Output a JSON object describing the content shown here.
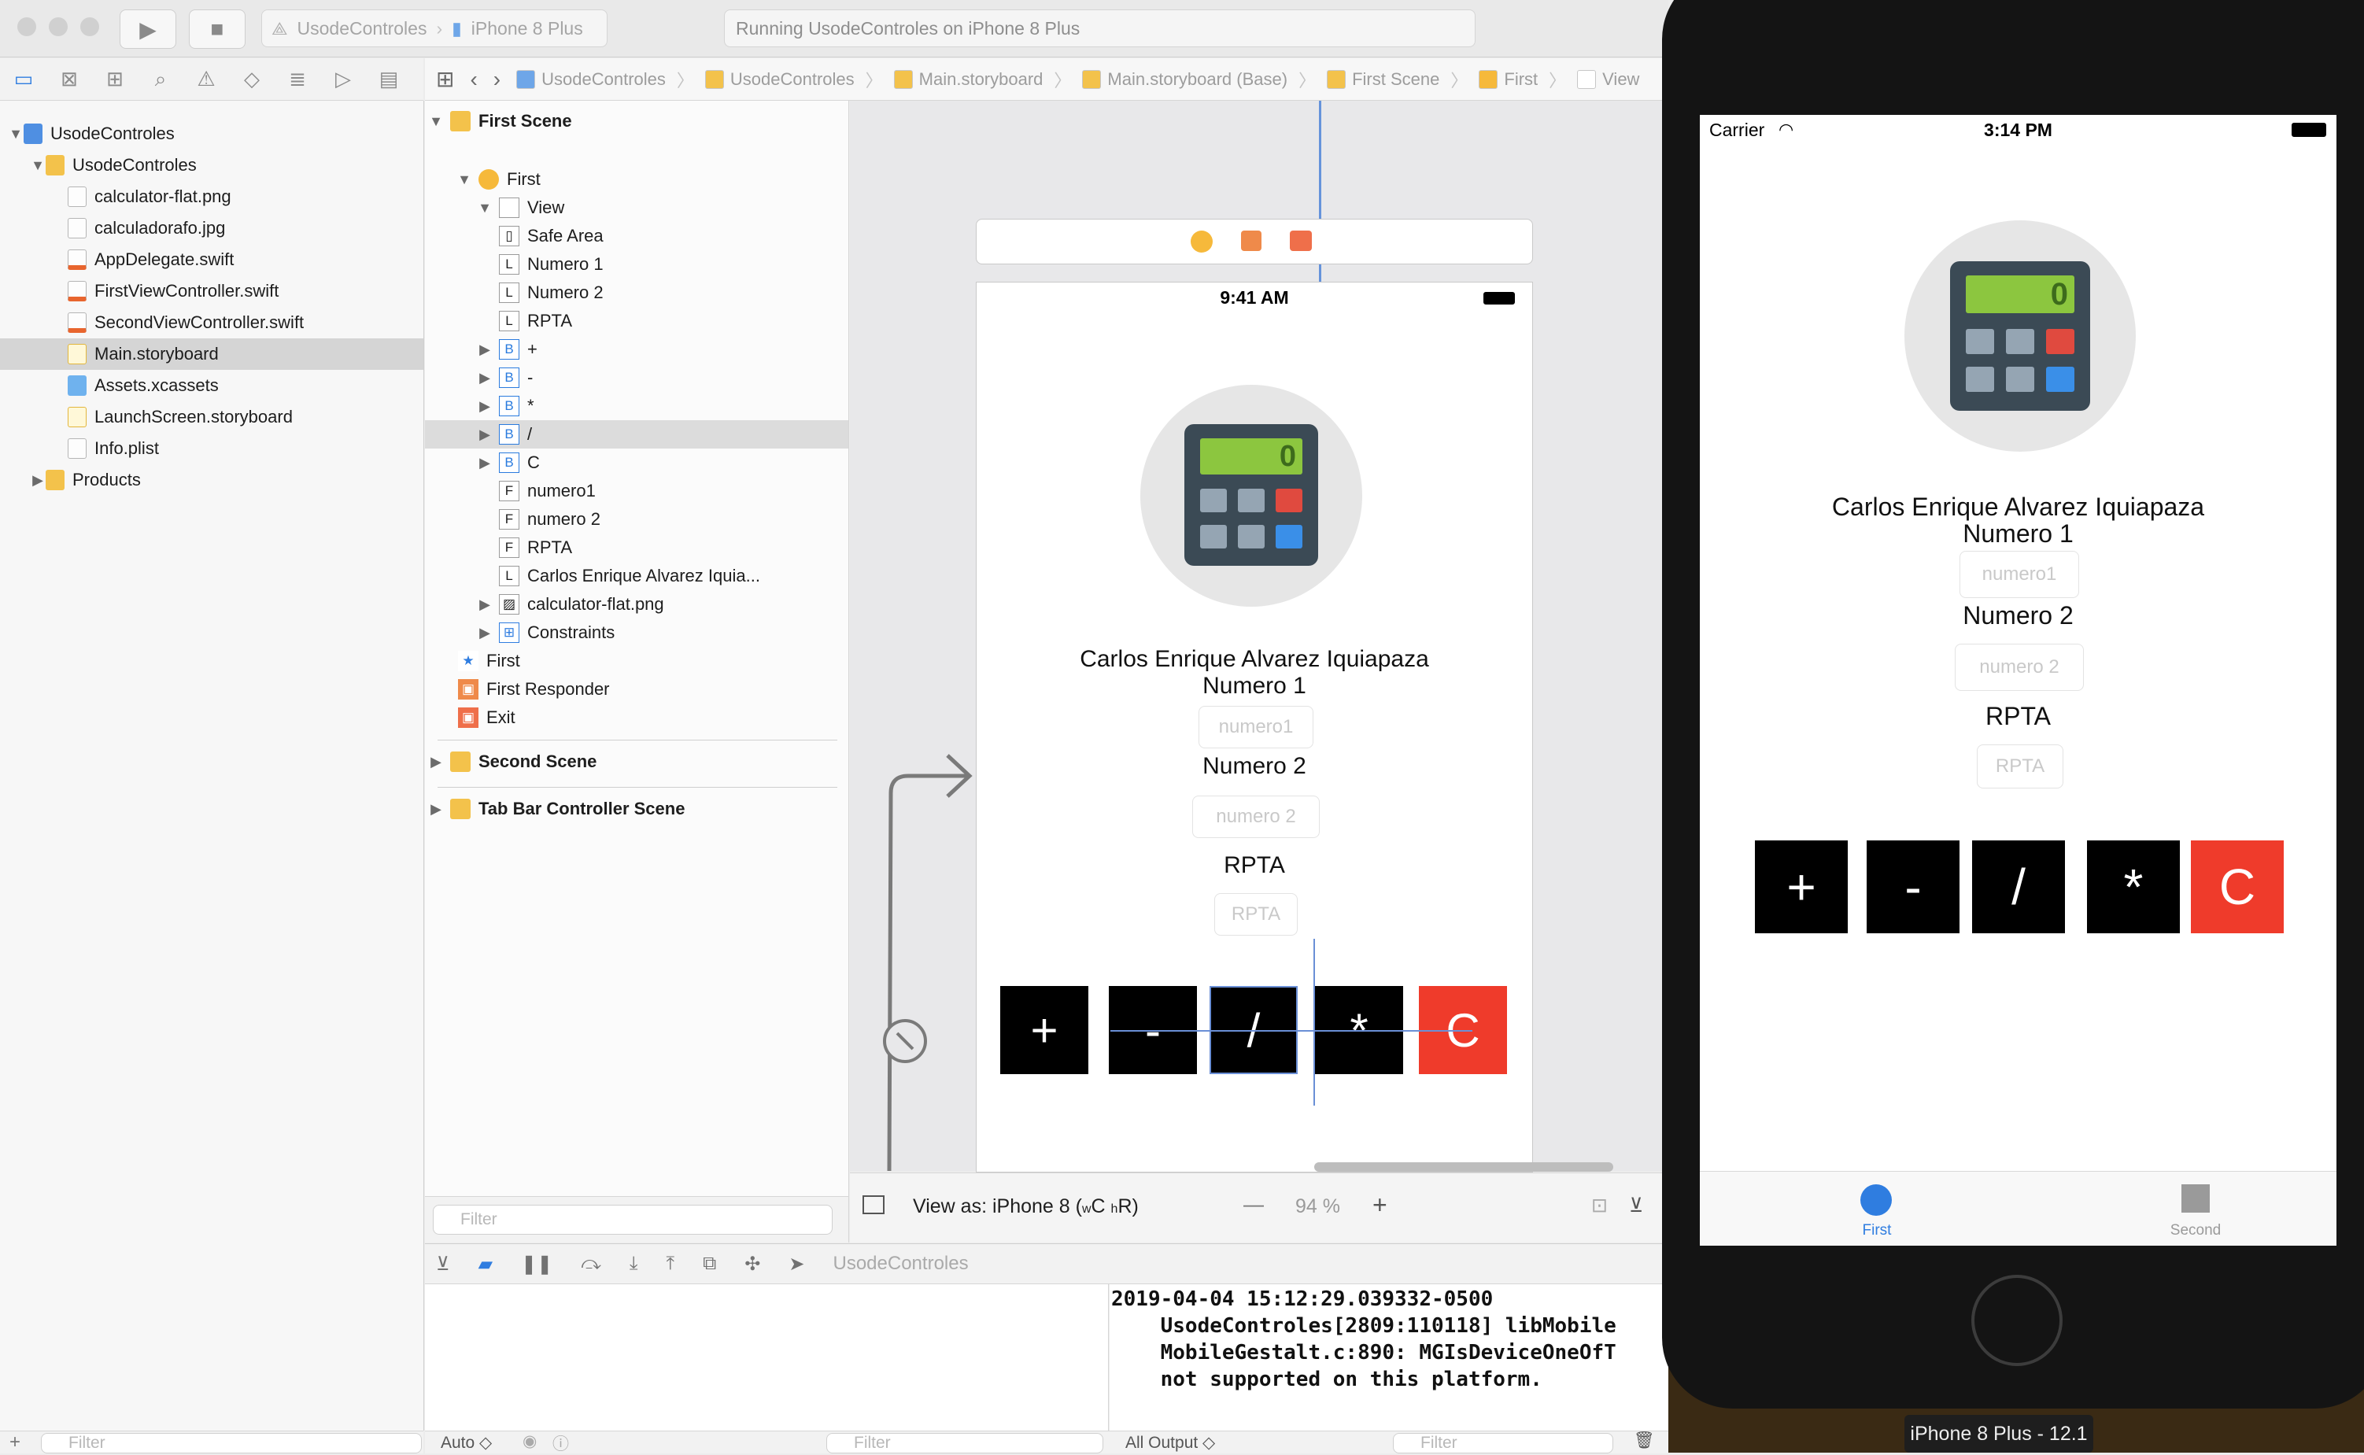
{
  "toolbar": {
    "scheme": "UsodeControles",
    "device": "iPhone 8 Plus",
    "status": "Running UsodeControles on iPhone 8 Plus"
  },
  "navigator": {
    "items": [
      {
        "label": "UsodeControles",
        "type": "project",
        "level": 0,
        "expanded": true
      },
      {
        "label": "UsodeControles",
        "type": "folder",
        "level": 1,
        "expanded": true
      },
      {
        "label": "calculator-flat.png",
        "type": "image",
        "level": 2
      },
      {
        "label": "calculadorafo.jpg",
        "type": "image",
        "level": 2
      },
      {
        "label": "AppDelegate.swift",
        "type": "swift",
        "level": 2
      },
      {
        "label": "FirstViewController.swift",
        "type": "swift",
        "level": 2
      },
      {
        "label": "SecondViewController.swift",
        "type": "swift",
        "level": 2
      },
      {
        "label": "Main.storyboard",
        "type": "storyboard",
        "level": 2,
        "selected": true
      },
      {
        "label": "Assets.xcassets",
        "type": "assets",
        "level": 2
      },
      {
        "label": "LaunchScreen.storyboard",
        "type": "storyboard",
        "level": 2
      },
      {
        "label": "Info.plist",
        "type": "doc",
        "level": 2
      },
      {
        "label": "Products",
        "type": "folder",
        "level": 1,
        "expanded": false
      }
    ],
    "filter_placeholder": "Filter"
  },
  "jumpbar": [
    "UsodeControles",
    "UsodeControles",
    "Main.storyboard",
    "Main.storyboard (Base)",
    "First Scene",
    "First",
    "View"
  ],
  "outline": {
    "first_scene": "First Scene",
    "rows": [
      {
        "label": "First",
        "badge": "vc"
      },
      {
        "label": "View",
        "badge": "view"
      },
      {
        "label": "Safe Area",
        "badge": "safe"
      },
      {
        "label": "Numero 1",
        "badge": "L"
      },
      {
        "label": "Numero 2",
        "badge": "L"
      },
      {
        "label": "RPTA",
        "badge": "L"
      },
      {
        "label": "+",
        "badge": "B"
      },
      {
        "label": "-",
        "badge": "B"
      },
      {
        "label": "*",
        "badge": "B"
      },
      {
        "label": "/",
        "badge": "B"
      },
      {
        "label": "C",
        "badge": "B"
      },
      {
        "label": "numero1",
        "badge": "F"
      },
      {
        "label": "numero 2",
        "badge": "F"
      },
      {
        "label": "RPTA",
        "badge": "F"
      },
      {
        "label": "Carlos Enrique Alvarez Iquia...",
        "badge": "L"
      },
      {
        "label": "calculator-flat.png",
        "badge": "img"
      },
      {
        "label": "Constraints",
        "badge": "cons"
      },
      {
        "label": "First",
        "badge": "star"
      },
      {
        "label": "First Responder",
        "badge": "resp"
      },
      {
        "label": "Exit",
        "badge": "exit"
      }
    ],
    "second_scene": "Second Scene",
    "tabbar_scene": "Tab Bar Controller Scene",
    "filter_placeholder": "Filter"
  },
  "canvas": {
    "time": "9:41 AM",
    "author": "Carlos Enrique Alvarez Iquiapaza",
    "label1": "Numero 1",
    "field1_placeholder": "numero1",
    "label2": "Numero 2",
    "field2_placeholder": "numero 2",
    "rpta_label": "RPTA",
    "rpta_placeholder": "RPTA",
    "buttons": [
      "+",
      "-",
      "/",
      "*",
      "C"
    ],
    "display_value": "0",
    "view_as": "View as: iPhone 8 (",
    "size_class_w": "w",
    "size_class_c": "C",
    "size_class_h": "h",
    "size_class_r": "R",
    "view_as_end": ")",
    "zoom_out": "—",
    "zoom": "94 %",
    "zoom_in": "+"
  },
  "debug": {
    "target": "UsodeControles",
    "console": "2019-04-04 15:12:29.039332-0500\n    UsodeControles[2809:110118] libMobile\n    MobileGestalt.c:890: MGIsDeviceOneOfT\n    not supported on this platform.",
    "auto": "Auto ◇",
    "filter_placeholder": "Filter",
    "all_output": "All Output ◇"
  },
  "simulator": {
    "carrier": "Carrier",
    "time": "3:14 PM",
    "author": "Carlos Enrique Alvarez Iquiapaza",
    "label1": "Numero 1",
    "field1_placeholder": "numero1",
    "label2": "Numero 2",
    "field2_placeholder": "numero 2",
    "rpta_label": "RPTA",
    "rpta_placeholder": "RPTA",
    "buttons": [
      "+",
      "-",
      "/",
      "*",
      "C"
    ],
    "display_value": "0",
    "tab_first": "First",
    "tab_second": "Second",
    "device_label": "iPhone 8 Plus - 12.1"
  },
  "colors": {
    "accent_blue": "#2f7de0",
    "button_black": "#000000",
    "button_red": "#ef3b2b",
    "calc_body": "#3b4a55",
    "calc_display": "#8cc63f"
  }
}
